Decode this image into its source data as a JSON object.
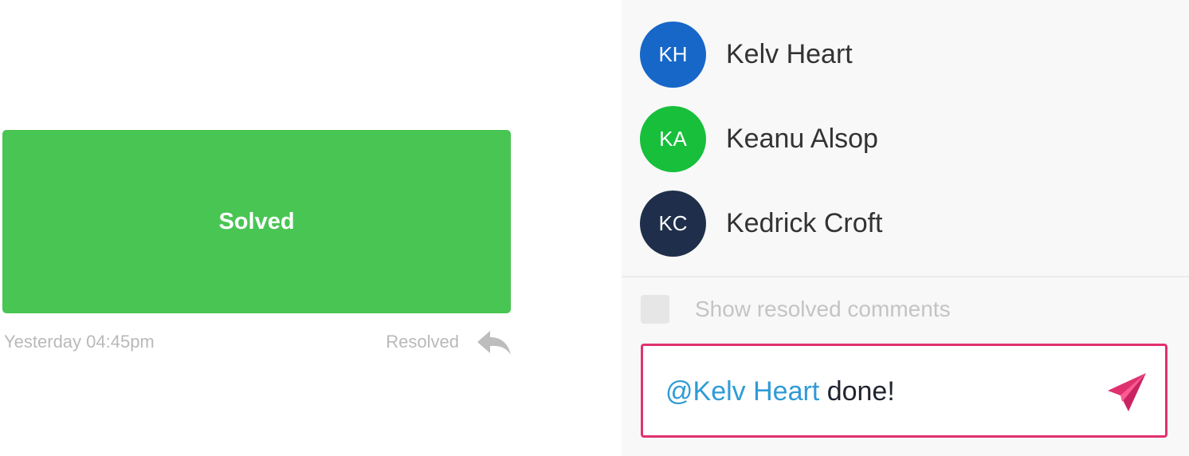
{
  "comment": {
    "body": "Solved",
    "timestamp": "Yesterday 04:45pm",
    "status": "Resolved",
    "reply_icon": "reply-arrow-icon",
    "block_color": "#48c553"
  },
  "mentions": [
    {
      "initials": "KH",
      "name": "Kelv Heart",
      "avatar_color": "#1767c8"
    },
    {
      "initials": "KA",
      "name": "Keanu Alsop",
      "avatar_color": "#17bf3b"
    },
    {
      "initials": "KC",
      "name": "Kedrick Croft",
      "avatar_color": "#1f2f4b"
    }
  ],
  "resolved_toggle": {
    "label": "Show resolved comments",
    "checked": false
  },
  "composer": {
    "mention": "@Kelv Heart",
    "text": " done!",
    "send_icon": "send-paper-plane-icon",
    "accent_color": "#e0316f",
    "mention_color": "#2f9bd6"
  }
}
